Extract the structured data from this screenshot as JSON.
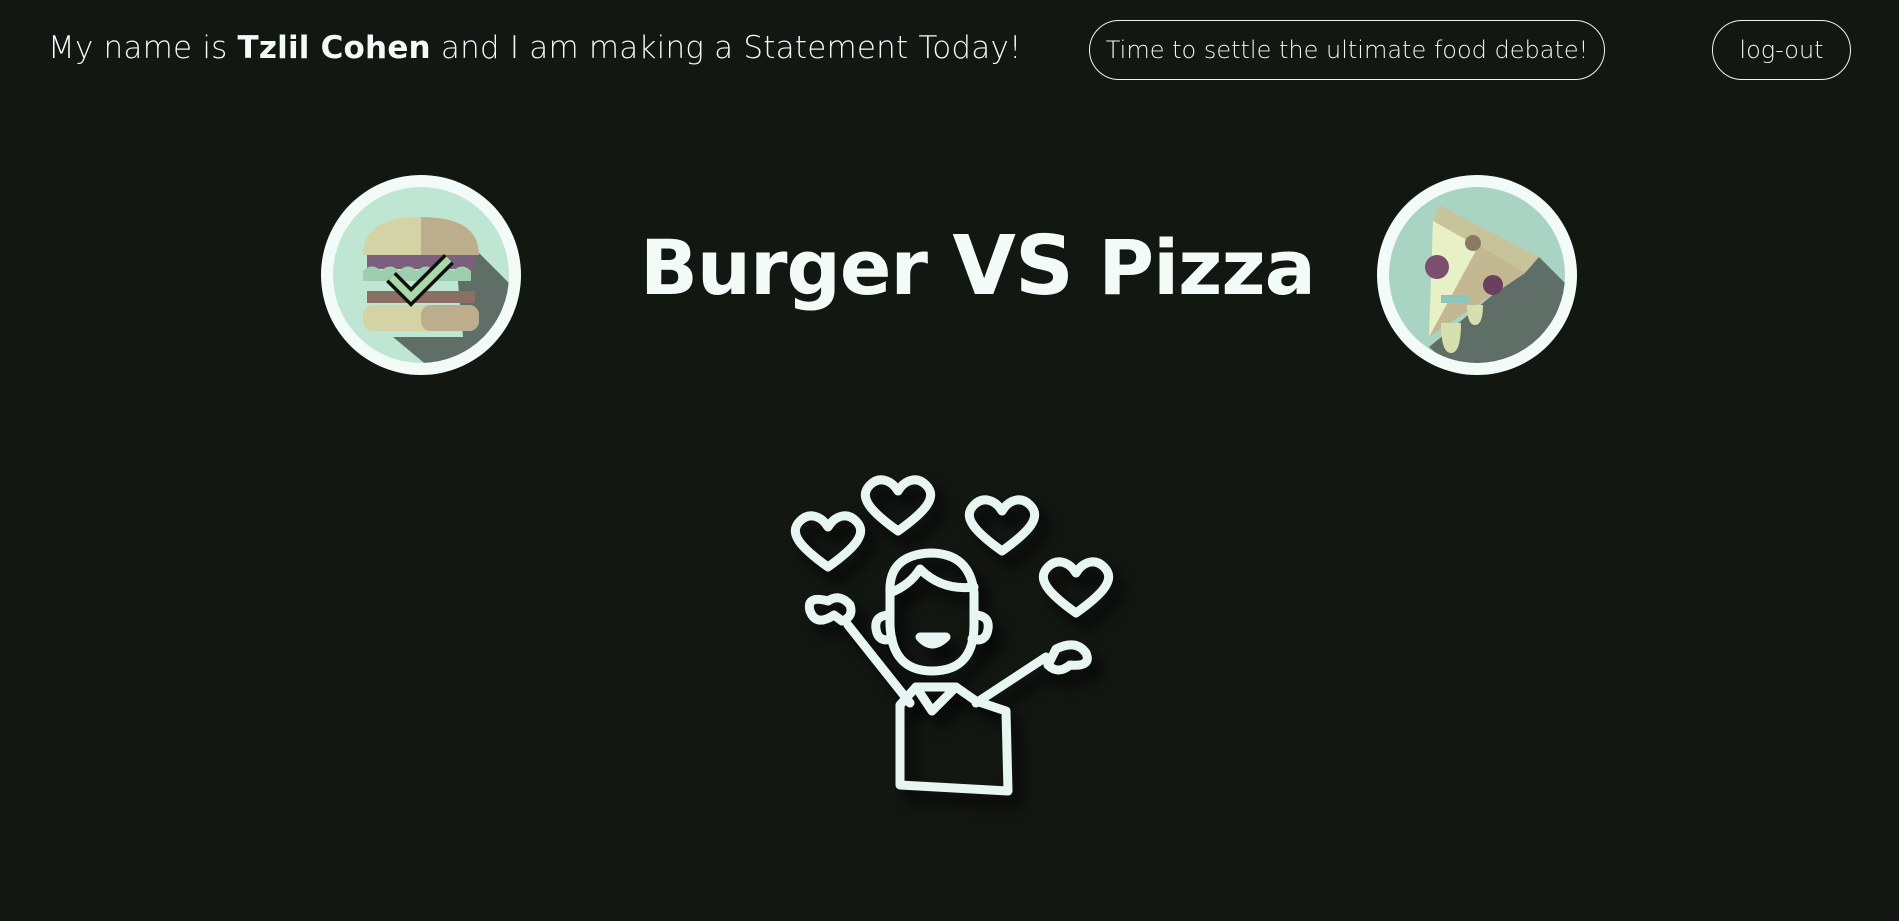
{
  "header": {
    "intro_prefix": "My name is ",
    "user_name": "Tzlil Cohen",
    "intro_suffix": " and I am making a Statement Today!",
    "debate_button_label": "Time to settle the ultimate food debate!",
    "logout_label": "log-out"
  },
  "main": {
    "title_left": "Burger",
    "title_vs": "VS",
    "title_right": "Pizza",
    "left_choice": {
      "icon": "burger-icon",
      "state": "selected"
    },
    "right_choice": {
      "icon": "pizza-icon",
      "state": "unselected"
    },
    "illustration": "celebrating-person-with-hearts-icon"
  },
  "colors": {
    "background": "#131712",
    "foreground": "#f3fbf9",
    "circle_bg": "#bfe6d2",
    "accent_check": "#a8d9a8"
  }
}
